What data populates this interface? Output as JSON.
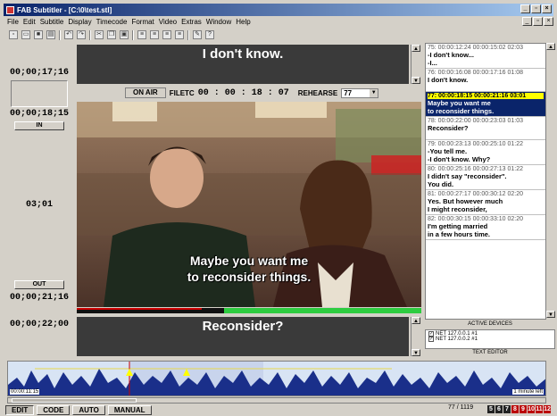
{
  "window": {
    "title": "FAB Subtitler - [C:\\0\\test.stl]"
  },
  "menu": [
    "File",
    "Edit",
    "Subtitle",
    "Display",
    "Timecode",
    "Format",
    "Video",
    "Extras",
    "Window",
    "Help"
  ],
  "left": {
    "tc_current": "00;00;17;16",
    "tc_in": "00;00;18;15",
    "in_label": "IN",
    "duration": "03;01",
    "out_label": "OUT",
    "tc_out": "00;00;21;16",
    "tc_next": "00;00;22;00"
  },
  "subtitles": {
    "previous": "I don't know.",
    "next": "Reconsider?",
    "overlay": [
      "Maybe you want me",
      "to reconsider things."
    ]
  },
  "status": {
    "on_air": "ON AIR",
    "filetc_label": "FILETC",
    "filetc": "00 : 00 : 18 : 07",
    "rehearse_label": "REHEARSE",
    "rehearse_value": "77"
  },
  "list": [
    {
      "hd": "75:  00:00:12:24  00:00:15:02  02:03",
      "l1": "-I don't know...",
      "l2": "-I..."
    },
    {
      "hd": "76:  00:00:16:08  00:00:17:16  01:08",
      "l1": "I don't know.",
      "l2": ""
    },
    {
      "hd": "77:  00:00:18:15  00:00:21:16  03:01",
      "l1": "Maybe you want me",
      "l2": "to reconsider things."
    },
    {
      "hd": "78:  00:00:22:00  00:00:23:03  01:03",
      "l1": "Reconsider?",
      "l2": ""
    },
    {
      "hd": "79:  00:00:23:13  00:00:25:10  01:22",
      "l1": "-You tell me.",
      "l2": "-I don't know. Why?"
    },
    {
      "hd": "80:  00:00:25:16  00:00:27:13  01:22",
      "l1": "I didn't say \"reconsider\".",
      "l2": "You did."
    },
    {
      "hd": "81:  00:00:27:17  00:00:30:12  02:20",
      "l1": "Yes. But however much",
      "l2": "I might reconsider,"
    },
    {
      "hd": "82:  00:00:30:15  00:00:33:10  02:20",
      "l1": "I'm getting married",
      "l2": "in a few hours time."
    }
  ],
  "devices": {
    "header": "ACTIVE DEVICES",
    "items": [
      "NET 127.0.0.1 #1",
      "NET 127.0.0.2 #1"
    ],
    "text_editor": "TEXT EDITOR"
  },
  "waveform": {
    "timecode": "00:00:11:15",
    "remaining": "1 minute left"
  },
  "bottom": {
    "buttons": [
      "EDIT",
      "CODE",
      "AUTO",
      "MANUAL"
    ],
    "count": "77 / 1119",
    "numbers": [
      "5",
      "6",
      "7",
      "8",
      "9",
      "10",
      "11",
      "12"
    ]
  },
  "colors": {
    "selection": "#0a246a",
    "highlight": "#ffff00",
    "progress": "#2ecc40"
  }
}
